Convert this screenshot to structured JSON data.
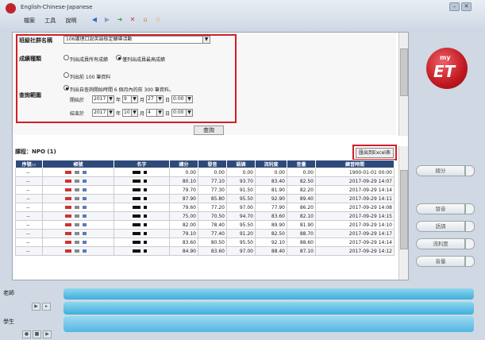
{
  "window": {
    "title": "English-Chinese-Japanese",
    "min": "–",
    "close": "✕"
  },
  "menu": [
    "檔案",
    "工具",
    "說明"
  ],
  "toolbar": [
    "◀",
    "▶",
    "➜",
    "✕",
    "⌂",
    "☆"
  ],
  "search": {
    "group_label": "班級社群名稱",
    "group_value": "106護理口說英語檢定輔導活動",
    "score_label": "成績種類",
    "score_opt1": "列出成員所有成績",
    "score_opt2": "僅列出成員最高成績",
    "range_label": "查詢範圍",
    "range_opt1": "列出前 100 筆資料",
    "range_opt2": "列出自查詢開始時間 6 個月內的前 300 筆資料。",
    "start_label": "開始於",
    "end_label": "結束於",
    "start": {
      "year": "2017",
      "month": "9",
      "day": "27",
      "time": "0:00"
    },
    "end": {
      "year": "2017",
      "month": "10",
      "day": "4",
      "time": "0:00"
    },
    "u_year": "年",
    "u_month": "月",
    "u_day": "日",
    "query_btn": "查詢"
  },
  "results": {
    "course": "課程：NPO (1)",
    "export": "匯出到Excel表",
    "headers": [
      "序號▭",
      "帳號",
      "名字",
      "總分",
      "發音",
      "語調",
      "流利度",
      "音量",
      "練習時間"
    ],
    "rows": [
      {
        "no": "--",
        "t": "0.00",
        "p": "0.00",
        "i": "0.00",
        "f": "0.00",
        "v": "0.00",
        "time": "1900-01-01 00:00"
      },
      {
        "no": "--",
        "t": "80.10",
        "p": "77.10",
        "i": "93.70",
        "f": "83.40",
        "v": "82.50",
        "time": "2017-09-29 14:07"
      },
      {
        "no": "--",
        "t": "79.70",
        "p": "77.30",
        "i": "91.50",
        "f": "81.90",
        "v": "82.20",
        "time": "2017-09-29 14:14"
      },
      {
        "no": "--",
        "t": "87.90",
        "p": "85.80",
        "i": "95.50",
        "f": "92.90",
        "v": "89.40",
        "time": "2017-09-29 14:11"
      },
      {
        "no": "--",
        "t": "79.60",
        "p": "77.20",
        "i": "97.00",
        "f": "77.90",
        "v": "86.20",
        "time": "2017-09-29 14:08"
      },
      {
        "no": "--",
        "t": "75.00",
        "p": "70.50",
        "i": "94.70",
        "f": "83.60",
        "v": "82.10",
        "time": "2017-09-29 14:15"
      },
      {
        "no": "--",
        "t": "82.00",
        "p": "78.40",
        "i": "95.50",
        "f": "89.90",
        "v": "81.90",
        "time": "2017-09-29 14:10"
      },
      {
        "no": "--",
        "t": "79.10",
        "p": "77.40",
        "i": "91.20",
        "f": "82.50",
        "v": "88.70",
        "time": "2017-09-29 14:17"
      },
      {
        "no": "--",
        "t": "83.60",
        "p": "80.50",
        "i": "95.50",
        "f": "92.10",
        "v": "88.60",
        "time": "2017-09-29 14:14"
      },
      {
        "no": "--",
        "t": "84.90",
        "p": "83.60",
        "i": "97.00",
        "f": "88.40",
        "v": "87.10",
        "time": "2017-09-29 14:12"
      }
    ]
  },
  "logo": {
    "my": "my",
    "et": "ET"
  },
  "side": [
    "總分",
    "發音",
    "語調",
    "流利度",
    "音量"
  ],
  "bottom": {
    "teacher": "老師",
    "student": "學生",
    "btn_play": "▶",
    "btn_stop": "■",
    "btn_rec": "●",
    "btn_next": "▶",
    "btn_save": "▸"
  },
  "colors": {
    "accent_red": "#d21e26",
    "header_blue": "#2f4a7a",
    "bar_blue": "#3eaede"
  }
}
